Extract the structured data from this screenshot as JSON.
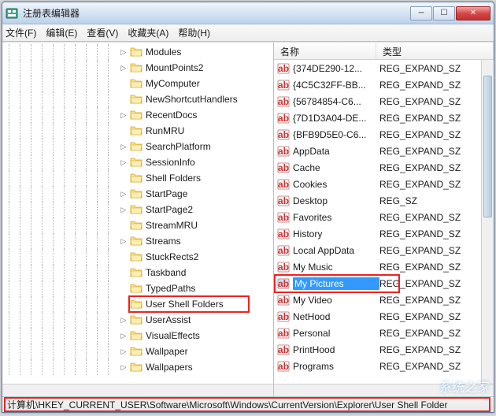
{
  "window": {
    "title": "注册表编辑器"
  },
  "menu": {
    "file": "文件(F)",
    "edit": "编辑(E)",
    "view": "查看(V)",
    "favorites": "收藏夹(A)",
    "help": "帮助(H)"
  },
  "tree": {
    "items": [
      {
        "label": "Modules",
        "exp": "▷"
      },
      {
        "label": "MountPoints2",
        "exp": "▷"
      },
      {
        "label": "MyComputer",
        "exp": ""
      },
      {
        "label": "NewShortcutHandlers",
        "exp": ""
      },
      {
        "label": "RecentDocs",
        "exp": "▷"
      },
      {
        "label": "RunMRU",
        "exp": ""
      },
      {
        "label": "SearchPlatform",
        "exp": "▷"
      },
      {
        "label": "SessionInfo",
        "exp": "▷"
      },
      {
        "label": "Shell Folders",
        "exp": ""
      },
      {
        "label": "StartPage",
        "exp": "▷"
      },
      {
        "label": "StartPage2",
        "exp": "▷"
      },
      {
        "label": "StreamMRU",
        "exp": ""
      },
      {
        "label": "Streams",
        "exp": "▷"
      },
      {
        "label": "StuckRects2",
        "exp": ""
      },
      {
        "label": "Taskband",
        "exp": ""
      },
      {
        "label": "TypedPaths",
        "exp": ""
      },
      {
        "label": "User Shell Folders",
        "exp": "",
        "hl": true
      },
      {
        "label": "UserAssist",
        "exp": "▷"
      },
      {
        "label": "VisualEffects",
        "exp": "▷"
      },
      {
        "label": "Wallpaper",
        "exp": "▷"
      },
      {
        "label": "Wallpapers",
        "exp": "▷"
      }
    ]
  },
  "list": {
    "header": {
      "name": "名称",
      "type": "类型"
    },
    "rows": [
      {
        "name": "{374DE290-12...",
        "type": "REG_EXPAND_SZ"
      },
      {
        "name": "{4C5C32FF-BB...",
        "type": "REG_EXPAND_SZ"
      },
      {
        "name": "{56784854-C6...",
        "type": "REG_EXPAND_SZ"
      },
      {
        "name": "{7D1D3A04-DE...",
        "type": "REG_EXPAND_SZ"
      },
      {
        "name": "{BFB9D5E0-C6...",
        "type": "REG_EXPAND_SZ"
      },
      {
        "name": "AppData",
        "type": "REG_EXPAND_SZ"
      },
      {
        "name": "Cache",
        "type": "REG_EXPAND_SZ"
      },
      {
        "name": "Cookies",
        "type": "REG_EXPAND_SZ"
      },
      {
        "name": "Desktop",
        "type": "REG_SZ"
      },
      {
        "name": "Favorites",
        "type": "REG_EXPAND_SZ"
      },
      {
        "name": "History",
        "type": "REG_EXPAND_SZ"
      },
      {
        "name": "Local AppData",
        "type": "REG_EXPAND_SZ"
      },
      {
        "name": "My Music",
        "type": "REG_EXPAND_SZ"
      },
      {
        "name": "My Pictures",
        "type": "REG_EXPAND_SZ",
        "selected": true
      },
      {
        "name": "My Video",
        "type": "REG_EXPAND_SZ"
      },
      {
        "name": "NetHood",
        "type": "REG_EXPAND_SZ"
      },
      {
        "name": "Personal",
        "type": "REG_EXPAND_SZ"
      },
      {
        "name": "PrintHood",
        "type": "REG_EXPAND_SZ"
      },
      {
        "name": "Programs",
        "type": "REG_EXPAND_SZ"
      }
    ]
  },
  "statusbar": {
    "path": "计算机\\HKEY_CURRENT_USER\\Software\\Microsoft\\Windows\\CurrentVersion\\Explorer\\User Shell Folder"
  },
  "watermark": "系统之家"
}
